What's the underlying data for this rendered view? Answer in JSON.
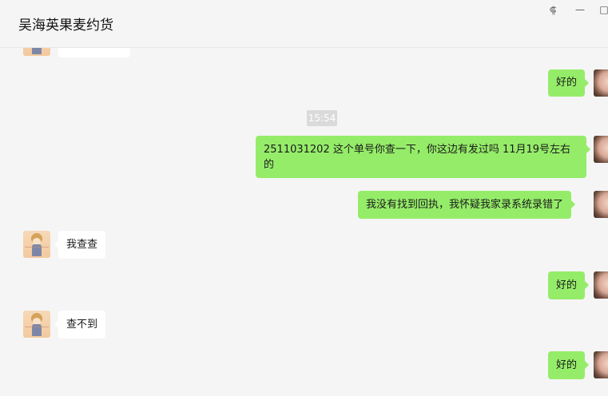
{
  "header": {
    "title": "吴海英果麦约货",
    "controls": {
      "pin": "⸿",
      "minimize": "—",
      "maximize": "□"
    }
  },
  "timestamp": "15:54",
  "messages": [
    {
      "sender": "me",
      "text": "好的"
    },
    {
      "sender": "me",
      "text": "2511031202 这个单号你查一下，你这边有发过吗  11月19号左右的"
    },
    {
      "sender": "me",
      "text": "我没有找到回执，我怀疑我家录系统录错了"
    },
    {
      "sender": "them",
      "text": "我查查"
    },
    {
      "sender": "me",
      "text": "好的"
    },
    {
      "sender": "them",
      "text": "查不到"
    },
    {
      "sender": "me",
      "text": "好的"
    }
  ]
}
